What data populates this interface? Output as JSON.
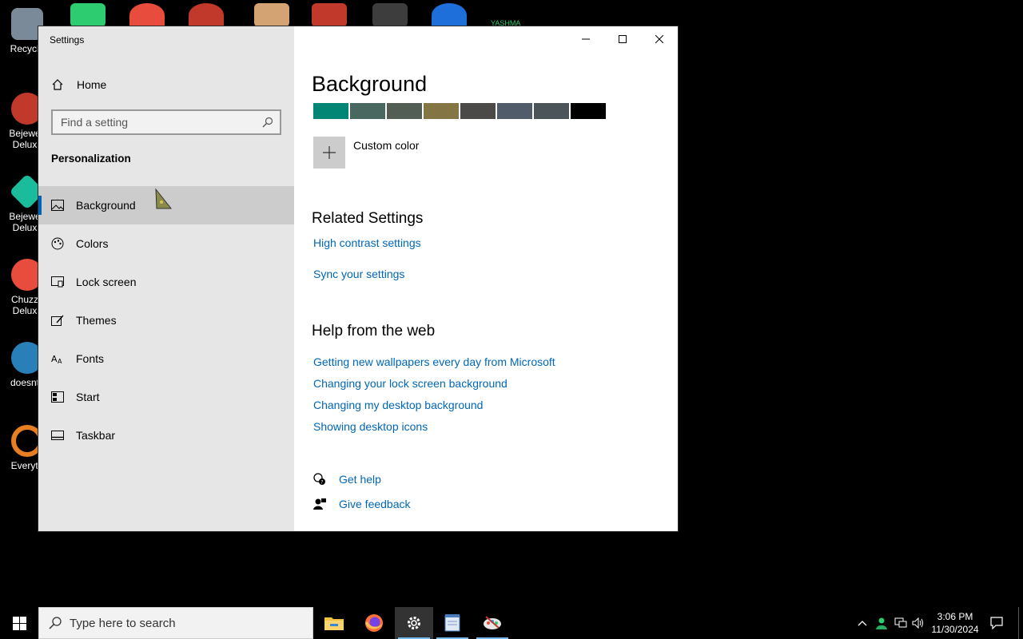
{
  "desktop": {
    "icons": [
      {
        "label": "Recycle",
        "color": "#7a8a99"
      },
      {
        "label": "Bejewe Delux",
        "color": "#c0392b"
      },
      {
        "label": "Bejewe Delux",
        "color": "#1abc9c"
      },
      {
        "label": "Chuzz Delux",
        "color": "#e74c3c"
      },
      {
        "label": "doesnt l",
        "color": "#2980b9"
      },
      {
        "label": "Everyth",
        "color": "#e67e22"
      }
    ],
    "top_text": "YASHMA"
  },
  "window": {
    "title": "Settings",
    "minimize_label": "Minimize",
    "maximize_label": "Maximize",
    "close_label": "Close"
  },
  "sidebar": {
    "home_label": "Home",
    "search_placeholder": "Find a setting",
    "section_title": "Personalization",
    "items": [
      {
        "label": "Background",
        "icon": "image-icon",
        "selected": true
      },
      {
        "label": "Colors",
        "icon": "palette-icon",
        "selected": false
      },
      {
        "label": "Lock screen",
        "icon": "lock-screen-icon",
        "selected": false
      },
      {
        "label": "Themes",
        "icon": "themes-icon",
        "selected": false
      },
      {
        "label": "Fonts",
        "icon": "fonts-icon",
        "selected": false
      },
      {
        "label": "Start",
        "icon": "start-icon",
        "selected": false
      },
      {
        "label": "Taskbar",
        "icon": "taskbar-icon",
        "selected": false
      }
    ]
  },
  "main": {
    "title": "Background",
    "swatches": [
      "#018574",
      "#486860",
      "#525e54",
      "#847545",
      "#4c4a48",
      "#515c6b",
      "#4a5459",
      "#000000"
    ],
    "custom_color_label": "Custom color",
    "related_title": "Related Settings",
    "related_links": [
      "High contrast settings",
      "Sync your settings"
    ],
    "help_title": "Help from the web",
    "help_links": [
      "Getting new wallpapers every day from Microsoft",
      "Changing your lock screen background",
      "Changing my desktop background",
      "Showing desktop icons"
    ],
    "get_help_label": "Get help",
    "give_feedback_label": "Give feedback"
  },
  "taskbar": {
    "search_placeholder": "Type here to search",
    "apps": [
      "file-explorer-icon",
      "firefox-icon",
      "settings-icon",
      "notepad-icon",
      "paint-icon"
    ],
    "time": "3:06 PM",
    "date": "11/30/2024",
    "accent": "#76b9ed"
  }
}
